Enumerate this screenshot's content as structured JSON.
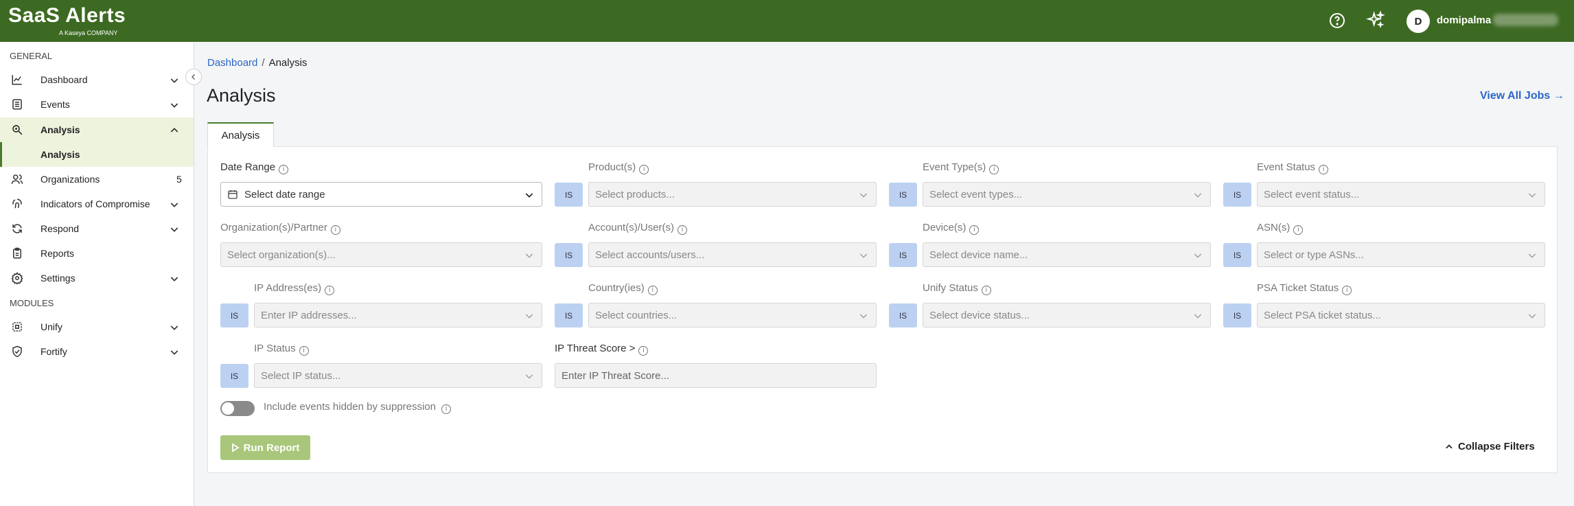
{
  "header": {
    "logo_text": "SaaS Alerts",
    "logo_sub": "A Kaseya COMPANY",
    "avatar_initial": "D",
    "user_name": "domipalma"
  },
  "sidebar": {
    "general_label": "GENERAL",
    "modules_label": "MODULES",
    "items": [
      {
        "label": "Dashboard"
      },
      {
        "label": "Events"
      },
      {
        "label": "Analysis"
      },
      {
        "label": "Analysis"
      },
      {
        "label": "Organizations",
        "count": "5"
      },
      {
        "label": "Indicators of Compromise"
      },
      {
        "label": "Respond"
      },
      {
        "label": "Reports"
      },
      {
        "label": "Settings"
      },
      {
        "label": "Unify"
      },
      {
        "label": "Fortify"
      }
    ]
  },
  "breadcrumb": {
    "root": "Dashboard",
    "separator": "/",
    "current": "Analysis"
  },
  "page": {
    "title": "Analysis",
    "view_jobs": "View All Jobs",
    "tab": "Analysis"
  },
  "filters": {
    "is_label": "IS",
    "date_range": {
      "label": "Date Range",
      "placeholder": "Select date range"
    },
    "products": {
      "label": "Product(s)",
      "placeholder": "Select products..."
    },
    "event_types": {
      "label": "Event Type(s)",
      "placeholder": "Select event types..."
    },
    "event_status": {
      "label": "Event Status",
      "placeholder": "Select event status..."
    },
    "organizations": {
      "label": "Organization(s)/Partner",
      "placeholder": "Select organization(s)..."
    },
    "accounts": {
      "label": "Account(s)/User(s)",
      "placeholder": "Select accounts/users..."
    },
    "devices": {
      "label": "Device(s)",
      "placeholder": "Select device name..."
    },
    "asns": {
      "label": "ASN(s)",
      "placeholder": "Select or type ASNs..."
    },
    "ip_addresses": {
      "label": "IP Address(es)",
      "placeholder": "Enter IP addresses..."
    },
    "countries": {
      "label": "Country(ies)",
      "placeholder": "Select countries..."
    },
    "unify_status": {
      "label": "Unify Status",
      "placeholder": "Select device status..."
    },
    "psa_status": {
      "label": "PSA Ticket Status",
      "placeholder": "Select PSA ticket status..."
    },
    "ip_status": {
      "label": "IP Status",
      "placeholder": "Select IP status..."
    },
    "ip_threat": {
      "label": "IP Threat Score >",
      "placeholder": "Enter IP Threat Score..."
    },
    "suppression_label": "Include events hidden by suppression",
    "run_report": "Run Report",
    "collapse_filters": "Collapse Filters"
  }
}
